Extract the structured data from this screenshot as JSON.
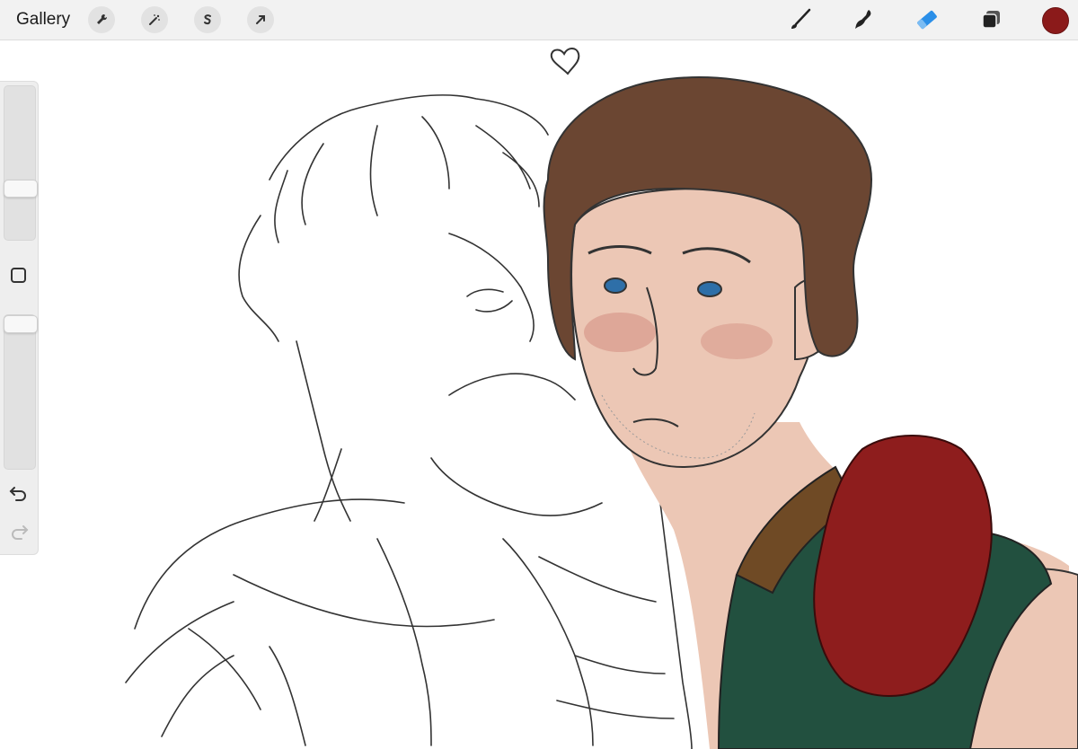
{
  "topbar": {
    "gallery_label": "Gallery",
    "left_tools": [
      "wrench-icon",
      "magic-wand-icon",
      "selection-icon",
      "transform-arrow-icon"
    ],
    "right_tools": [
      "brush-icon",
      "smudge-icon",
      "eraser-icon",
      "layers-icon"
    ],
    "active_tool": "eraser-icon",
    "current_color": "#8b1a1a",
    "active_tool_color": "#2b8fe8"
  },
  "sidebar": {
    "brush_size_slider_value": 0.58,
    "opacity_slider_value": 0.05
  },
  "canvas": {
    "description_colors": {
      "hair": "#6b4632",
      "skin": "#ecc7b5",
      "shirt": "#22503f",
      "glove": "#8e1d1d",
      "strap": "#6f4a25",
      "eyes": "#2e6fa8"
    }
  }
}
